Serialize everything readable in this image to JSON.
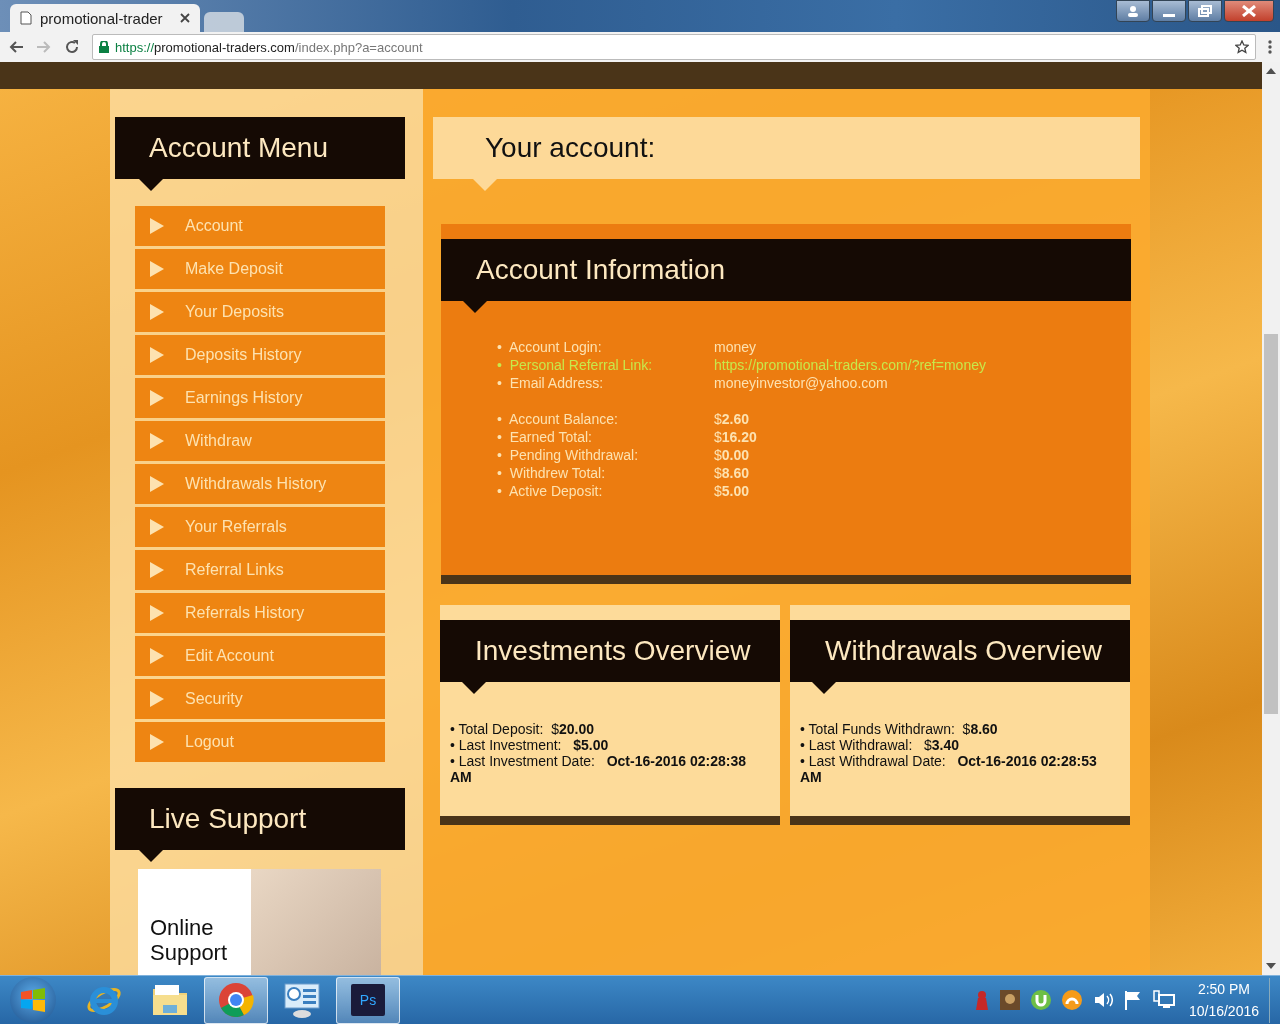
{
  "browser": {
    "tabs": [
      {
        "title": "promotional-trader",
        "selected": true
      },
      {
        "selected": false
      }
    ],
    "url": {
      "scheme": "https://",
      "host": "promotional-traders.com",
      "path": "/index.php?a=account"
    }
  },
  "sidebar": {
    "menu_title": "Account Menu",
    "menu_items": [
      {
        "label": "Account"
      },
      {
        "label": "Make Deposit"
      },
      {
        "label": "Your Deposits"
      },
      {
        "label": "Deposits History"
      },
      {
        "label": "Earnings History"
      },
      {
        "label": "Withdraw"
      },
      {
        "label": "Withdrawals History"
      },
      {
        "label": "Your Referrals"
      },
      {
        "label": "Referral Links"
      },
      {
        "label": "Referrals History"
      },
      {
        "label": "Edit Account"
      },
      {
        "label": "Security"
      },
      {
        "label": "Logout"
      }
    ],
    "support_title": "Live Support",
    "support_banner": "Online Support"
  },
  "page_title": "Your account:",
  "account_info": {
    "title": "Account Information",
    "groups": [
      [
        {
          "label": "•  Account Login:",
          "value": "money",
          "kind": "plain"
        },
        {
          "label": "•  Personal Referral Link:",
          "value": "https://promotional-traders.com/?ref=money",
          "kind": "link"
        },
        {
          "label": "•  Email Address:",
          "value": "moneyinvestor@yahoo.com",
          "kind": "plain"
        }
      ],
      [
        {
          "label": "•  Account Balance:",
          "value": "$**2.60**",
          "kind": "money"
        },
        {
          "label": "•  Earned Total:",
          "value": "$**16.20**",
          "kind": "money"
        },
        {
          "label": "•  Pending Withdrawal:",
          "value": "$**0.00**",
          "kind": "money"
        },
        {
          "label": "•  Withdrew Total:",
          "value": "$**8.60**",
          "kind": "money"
        },
        {
          "label": "•  Active Deposit:",
          "value": "$**5.00**",
          "kind": "money"
        }
      ]
    ]
  },
  "overviews": [
    {
      "title": "Investments Overview",
      "lines": [
        "• Total Deposit:  $**20.00**",
        "• Last Investment:   **$5.00**",
        "• Last Investment Date:   **Oct-16-2016 02:28:38 AM**"
      ]
    },
    {
      "title": "Withdrawals Overview",
      "lines": [
        "• Total Funds Withdrawn:  $**8.60**",
        "• Last Withdrawal:   $**3.40**",
        "• Last Withdrawal Date:   **Oct-16-2016 02:28:53 AM**"
      ]
    }
  ],
  "taskbar": {
    "apps": [
      {
        "kind": "ie",
        "selected": false
      },
      {
        "kind": "folder",
        "selected": false
      },
      {
        "kind": "chrome",
        "selected": true
      },
      {
        "kind": "panel",
        "selected": false
      },
      {
        "kind": "ps",
        "label": "Ps",
        "selected": true
      }
    ],
    "tray": [
      {
        "kind": "red"
      },
      {
        "kind": "game"
      },
      {
        "kind": "torrent"
      },
      {
        "kind": "ring"
      },
      {
        "kind": "volume"
      },
      {
        "kind": "flag"
      },
      {
        "kind": "network"
      }
    ],
    "time": "2:50 PM",
    "date": "10/16/2016"
  }
}
